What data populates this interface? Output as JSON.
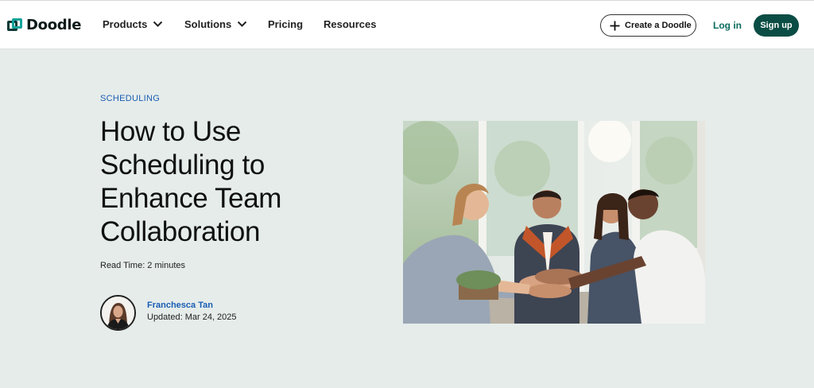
{
  "header": {
    "logo_text": "Doodle",
    "nav": [
      {
        "label": "Products"
      },
      {
        "label": "Solutions"
      },
      {
        "label": "Pricing"
      },
      {
        "label": "Resources"
      }
    ],
    "create_label": "Create a Doodle",
    "login_label": "Log in",
    "signup_label": "Sign up"
  },
  "article": {
    "category": "SCHEDULING",
    "title": "How to Use Scheduling to Enhance Team Collaboration",
    "read_time": "Read Time: 2 minutes",
    "author_name": "Franchesca Tan",
    "updated": "Updated: Mar 24, 2025"
  },
  "colors": {
    "page_bg": "#e5ecea",
    "brand_dark": "#0b4d44",
    "link_blue": "#1a5db3",
    "logo_teal": "#14a39a"
  },
  "icons": [
    "chevron-down-icon",
    "plus-icon"
  ]
}
